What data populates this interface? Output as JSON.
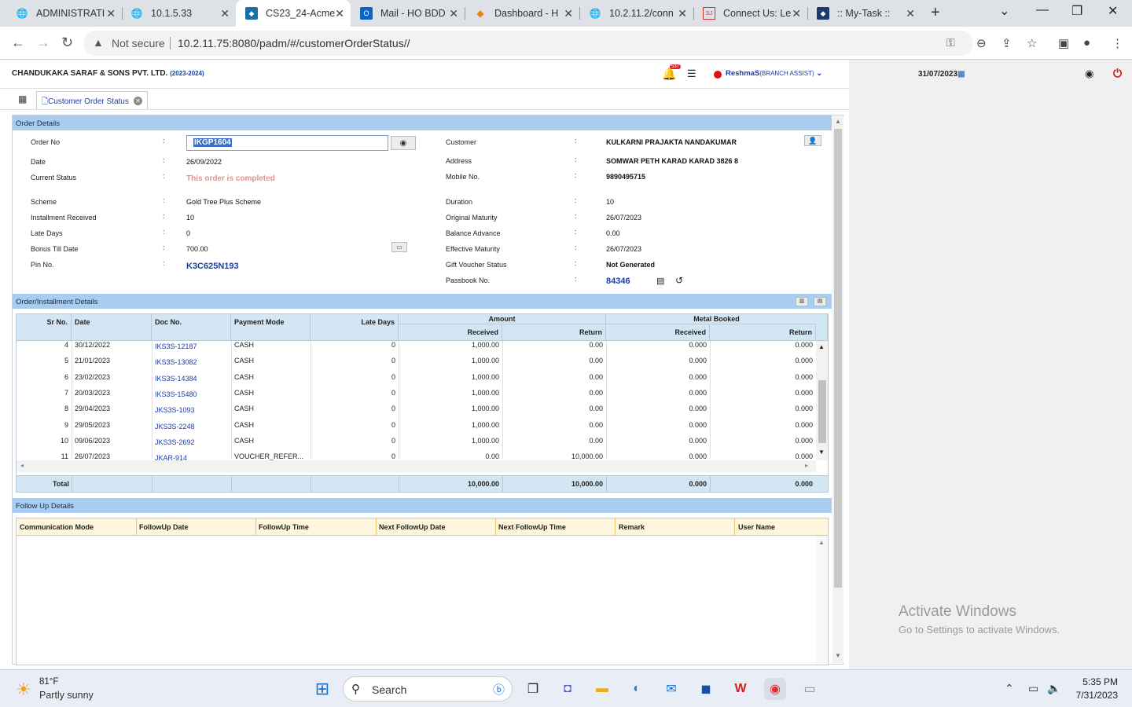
{
  "browser": {
    "tabs": [
      {
        "title": "ADMINISTRATI",
        "icon": "globe-icon"
      },
      {
        "title": "10.1.5.33",
        "icon": "globe-icon"
      },
      {
        "title": "CS23_24-Acme",
        "icon": "app-icon"
      },
      {
        "title": "Mail - HO BDD",
        "icon": "outlook-icon"
      },
      {
        "title": "Dashboard - H",
        "icon": "dashboard-icon"
      },
      {
        "title": "10.2.11.2/conn",
        "icon": "globe-icon"
      },
      {
        "title": "Connect Us: Le",
        "icon": "site-icon"
      },
      {
        "title": ":: My-Task ::",
        "icon": "app-icon"
      }
    ],
    "not_secure": "Not secure",
    "url": "10.2.11.75:8080/padm/#/customerOrderStatus//"
  },
  "header": {
    "company": "CHANDUKAKA SARAF & SONS PVT. LTD.",
    "year": "(2023-2024)",
    "badge": "537",
    "user": "ReshmaS",
    "role": "(BRANCH ASSIST)",
    "date": "31/07/2023"
  },
  "page_tab": {
    "label": "Customer Order Status"
  },
  "order": {
    "section": "Order Details",
    "order_no_label": "Order No",
    "order_no": "IKGP1604",
    "date_label": "Date",
    "date": "26/09/2022",
    "status_label": "Current Status",
    "status": "This order is completed",
    "scheme_label": "Scheme",
    "scheme": "Gold Tree Plus Scheme",
    "inst_label": "Installment Received",
    "inst": "10",
    "late_label": "Late Days",
    "late": "0",
    "bonus_label": "Bonus Till Date",
    "bonus": "700.00",
    "pin_label": "Pin No.",
    "pin": "K3C625N193",
    "customer_label": "Customer",
    "customer": "KULKARNI PRAJAKTA NANDAKUMAR",
    "address_label": "Address",
    "address": "SOMWAR PETH KARAD KARAD 3826 8",
    "mobile_label": "Mobile No.",
    "mobile": "9890495715",
    "duration_label": "Duration",
    "duration": "10",
    "orig_mat_label": "Original Maturity",
    "orig_mat": "26/07/2023",
    "bal_label": "Balance Advance",
    "bal": "0.00",
    "eff_mat_label": "Effective Maturity",
    "eff_mat": "26/07/2023",
    "gift_label": "Gift Voucher Status",
    "gift": "Not Generated",
    "passbook_label": "Passbook No.",
    "passbook": "84346",
    "colon": ":"
  },
  "installments": {
    "section": "Order/Installment Details",
    "headers": {
      "sr": "Sr No.",
      "date": "Date",
      "doc": "Doc No.",
      "mode": "Payment Mode",
      "late": "Late Days",
      "amount": "Amount",
      "metal": "Metal Booked",
      "received": "Received",
      "return": "Return"
    },
    "rows": [
      {
        "sr": "4",
        "date": "30/12/2022",
        "doc": "IKS3S-12187",
        "mode": "CASH",
        "late": "0",
        "ar": "1,000.00",
        "at": "0.00",
        "mr": "0.000",
        "mt": "0.000"
      },
      {
        "sr": "5",
        "date": "21/01/2023",
        "doc": "IKS3S-13082",
        "mode": "CASH",
        "late": "0",
        "ar": "1,000.00",
        "at": "0.00",
        "mr": "0.000",
        "mt": "0.000"
      },
      {
        "sr": "6",
        "date": "23/02/2023",
        "doc": "IKS3S-14384",
        "mode": "CASH",
        "late": "0",
        "ar": "1,000.00",
        "at": "0.00",
        "mr": "0.000",
        "mt": "0.000"
      },
      {
        "sr": "7",
        "date": "20/03/2023",
        "doc": "IKS3S-15480",
        "mode": "CASH",
        "late": "0",
        "ar": "1,000.00",
        "at": "0.00",
        "mr": "0.000",
        "mt": "0.000"
      },
      {
        "sr": "8",
        "date": "29/04/2023",
        "doc": "JKS3S-1093",
        "mode": "CASH",
        "late": "0",
        "ar": "1,000.00",
        "at": "0.00",
        "mr": "0.000",
        "mt": "0.000"
      },
      {
        "sr": "9",
        "date": "29/05/2023",
        "doc": "JKS3S-2248",
        "mode": "CASH",
        "late": "0",
        "ar": "1,000.00",
        "at": "0.00",
        "mr": "0.000",
        "mt": "0.000"
      },
      {
        "sr": "10",
        "date": "09/06/2023",
        "doc": "JKS3S-2692",
        "mode": "CASH",
        "late": "0",
        "ar": "1,000.00",
        "at": "0.00",
        "mr": "0.000",
        "mt": "0.000"
      },
      {
        "sr": "11",
        "date": "26/07/2023",
        "doc": "JKAR-914",
        "mode": "VOUCHER_REFER...",
        "late": "0",
        "ar": "0.00",
        "at": "10,000.00",
        "mr": "0.000",
        "mt": "0.000"
      }
    ],
    "total": {
      "label": "Total",
      "ar": "10,000.00",
      "at": "10,000.00",
      "mr": "0.000",
      "mt": "0.000"
    }
  },
  "followup": {
    "section": "Follow Up Details",
    "headers": [
      "Communication Mode",
      "FollowUp Date",
      "FollowUp Time",
      "Next FollowUp Date",
      "Next FollowUp Time",
      "Remark",
      "User Name"
    ]
  },
  "watermark": {
    "line1": "Activate Windows",
    "line2": "Go to Settings to activate Windows."
  },
  "taskbar": {
    "temp": "81°F",
    "weather": "Partly sunny",
    "search": "Search",
    "time": "5:35 PM",
    "date": "7/31/2023"
  }
}
